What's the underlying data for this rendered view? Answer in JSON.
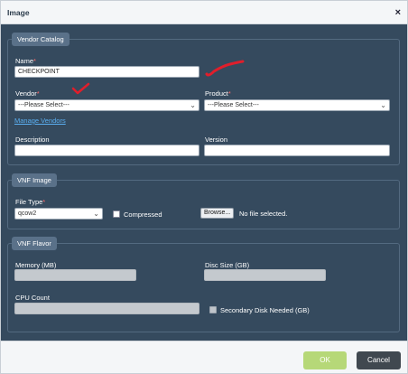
{
  "dialog": {
    "title": "Image",
    "close_glyph": "×"
  },
  "vendor_catalog": {
    "legend": "Vendor Catalog",
    "name_label": "Name",
    "name_value": "CHECKPOINT",
    "vendor_label": "Vendor",
    "vendor_selected": "---Please Select---",
    "product_label": "Product",
    "product_selected": "---Please Select---",
    "manage_vendors_link": "Manage Vendors",
    "description_label": "Description",
    "description_value": "",
    "version_label": "Version",
    "version_value": ""
  },
  "vnf_image": {
    "legend": "VNF Image",
    "file_type_label": "File Type",
    "file_type_selected": "qcow2",
    "compressed_label": "Compressed",
    "compressed_checked": false,
    "browse_label": "Browse...",
    "file_status": "No file selected."
  },
  "vnf_flavor": {
    "legend": "VNF Flavor",
    "memory_label": "Memory (MB)",
    "disc_size_label": "Disc Size (GB)",
    "cpu_count_label": "CPU Count",
    "secondary_disk_label": "Secondary Disk Needed (GB)",
    "secondary_disk_checked": false
  },
  "required_marker": "*",
  "footer": {
    "ok_label": "OK",
    "cancel_label": "Cancel"
  },
  "icons": {
    "close": "close-icon",
    "chevron": "chevron-down-icon",
    "annotation": "red-pen-mark"
  },
  "colors": {
    "panel": "#354a5e",
    "legend": "#5a7189",
    "ok": "#b6d878",
    "cancel": "#404850",
    "annotation": "#e01e2b"
  }
}
